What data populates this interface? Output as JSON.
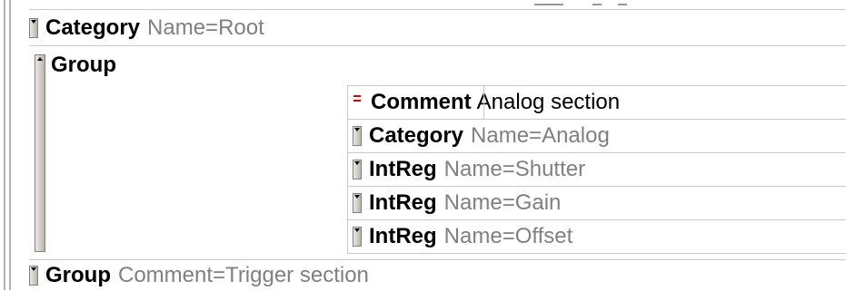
{
  "root_category": {
    "tag": "Category",
    "attr": "Name=Root"
  },
  "group_1": {
    "tag": "Group",
    "children": [
      {
        "type": "comment",
        "tag": "Comment",
        "value": "Analog section"
      },
      {
        "type": "node",
        "tag": "Category",
        "attr": "Name=Analog"
      },
      {
        "type": "node",
        "tag": "IntReg",
        "attr": "Name=Shutter"
      },
      {
        "type": "node",
        "tag": "IntReg",
        "attr": "Name=Gain"
      },
      {
        "type": "node",
        "tag": "IntReg",
        "attr": "Name=Offset"
      }
    ]
  },
  "group_2": {
    "tag": "Group",
    "attr": "Comment=Trigger section"
  }
}
